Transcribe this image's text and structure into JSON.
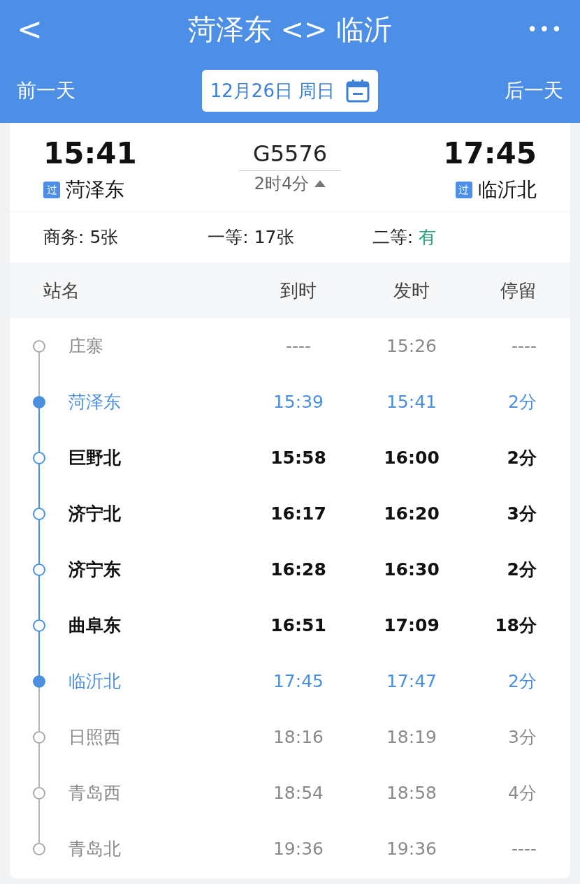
{
  "header": {
    "back": "<",
    "title": "菏泽东 <> 临沂",
    "more": "•••",
    "prev_day": "前一天",
    "date": "12月26日 周日",
    "next_day": "后一天"
  },
  "train": {
    "depart_time": "15:41",
    "depart_badge": "过",
    "depart_station": "菏泽东",
    "number": "G5576",
    "duration": "2时4分",
    "arrive_time": "17:45",
    "arrive_badge": "过",
    "arrive_station": "临沂北"
  },
  "seats": [
    {
      "label": "商务: ",
      "value": "5张",
      "available": false
    },
    {
      "label": "一等: ",
      "value": "17张",
      "available": false
    },
    {
      "label": "二等: ",
      "value": "有",
      "available": true
    }
  ],
  "columns": [
    "站名",
    "到时",
    "发时",
    "停留"
  ],
  "stops": [
    {
      "kind": "outside",
      "name": "庄寨",
      "arrive": "----",
      "depart": "15:26",
      "stay": "----"
    },
    {
      "kind": "endpoint",
      "name": "菏泽东",
      "arrive": "15:39",
      "depart": "15:41",
      "stay": "2分"
    },
    {
      "kind": "between",
      "name": "巨野北",
      "arrive": "15:58",
      "depart": "16:00",
      "stay": "2分"
    },
    {
      "kind": "between",
      "name": "济宁北",
      "arrive": "16:17",
      "depart": "16:20",
      "stay": "3分"
    },
    {
      "kind": "between",
      "name": "济宁东",
      "arrive": "16:28",
      "depart": "16:30",
      "stay": "2分"
    },
    {
      "kind": "between",
      "name": "曲阜东",
      "arrive": "16:51",
      "depart": "17:09",
      "stay": "18分"
    },
    {
      "kind": "endpoint",
      "name": "临沂北",
      "arrive": "17:45",
      "depart": "17:47",
      "stay": "2分"
    },
    {
      "kind": "outside",
      "name": "日照西",
      "arrive": "18:16",
      "depart": "18:19",
      "stay": "3分"
    },
    {
      "kind": "outside",
      "name": "青岛西",
      "arrive": "18:54",
      "depart": "18:58",
      "stay": "4分"
    },
    {
      "kind": "outside",
      "name": "青岛北",
      "arrive": "19:36",
      "depart": "19:36",
      "stay": "----"
    }
  ]
}
